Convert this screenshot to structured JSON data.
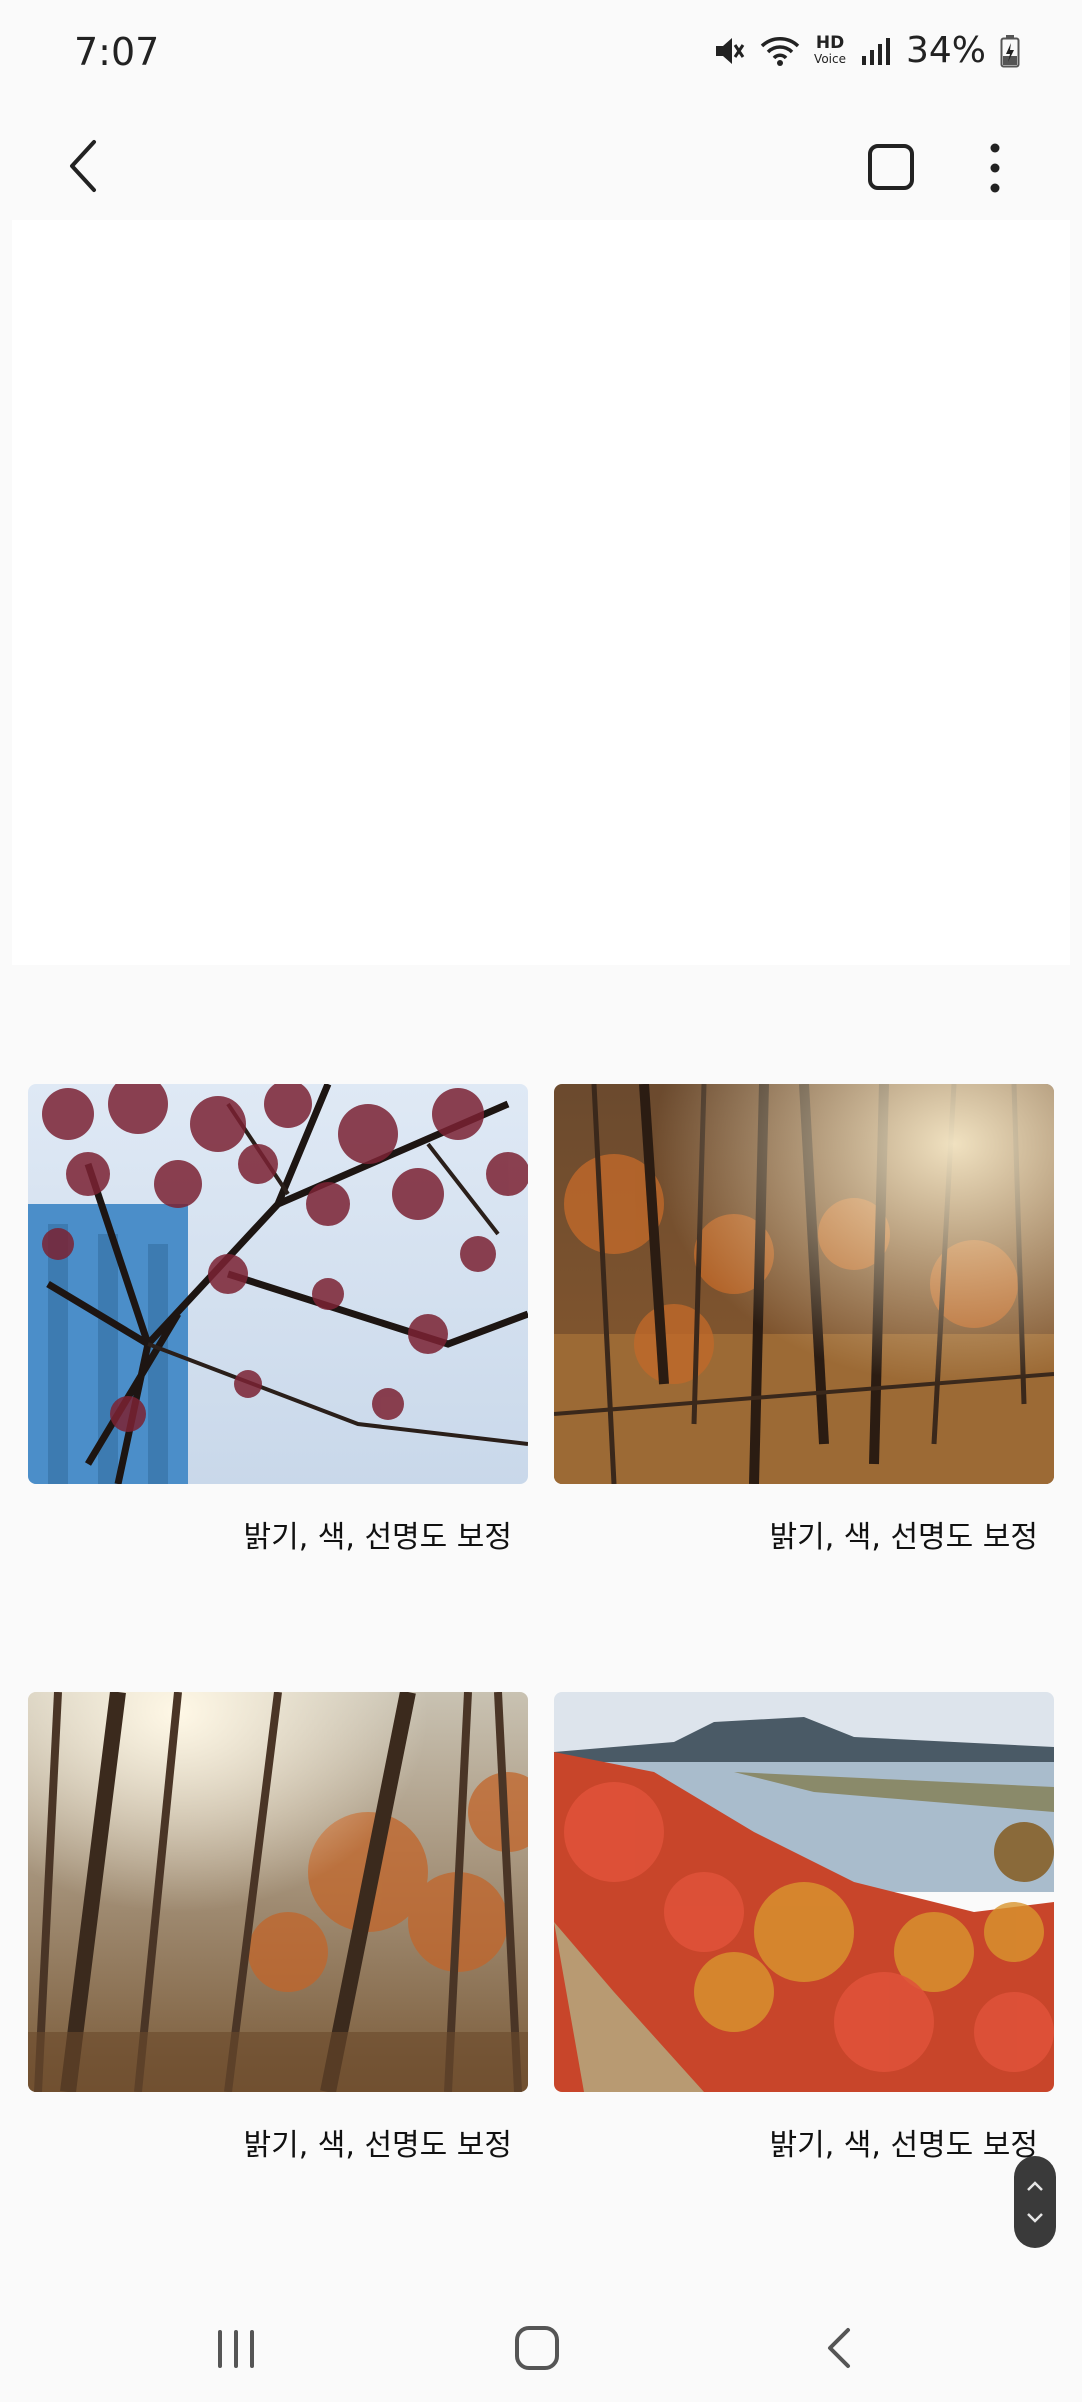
{
  "status_bar": {
    "time": "7:07",
    "battery": "34%",
    "hd_label": "HD",
    "voice_label": "Voice",
    "icons": [
      "mute-icon",
      "wifi-icon",
      "hd-voice-icon",
      "signal-icon",
      "battery-charging-icon"
    ]
  },
  "toolbar": {
    "icons": [
      "back-arrow-icon",
      "select-square-icon",
      "more-vertical-icon"
    ]
  },
  "gallery": {
    "items": [
      {
        "caption": "밝기, 색, 선명도 보정",
        "scene": "red-leaves-against-sky"
      },
      {
        "caption": "밝기, 색, 선명도 보정",
        "scene": "autumn-forest-sunlight"
      },
      {
        "caption": "밝기, 색, 선명도 보정",
        "scene": "backlit-forest-trees"
      },
      {
        "caption": "밝기, 색, 선명도 보정",
        "scene": "riverside-red-shrubs"
      }
    ]
  },
  "scroll_handle": {
    "icons": [
      "chevron-up-icon",
      "chevron-down-icon"
    ]
  },
  "nav_bar": {
    "icons": [
      "recents-icon",
      "home-icon",
      "back-icon"
    ]
  },
  "colors": {
    "background": "#fafafa",
    "panel": "#ffffff",
    "scroll_handle": "#3a3a3a"
  }
}
